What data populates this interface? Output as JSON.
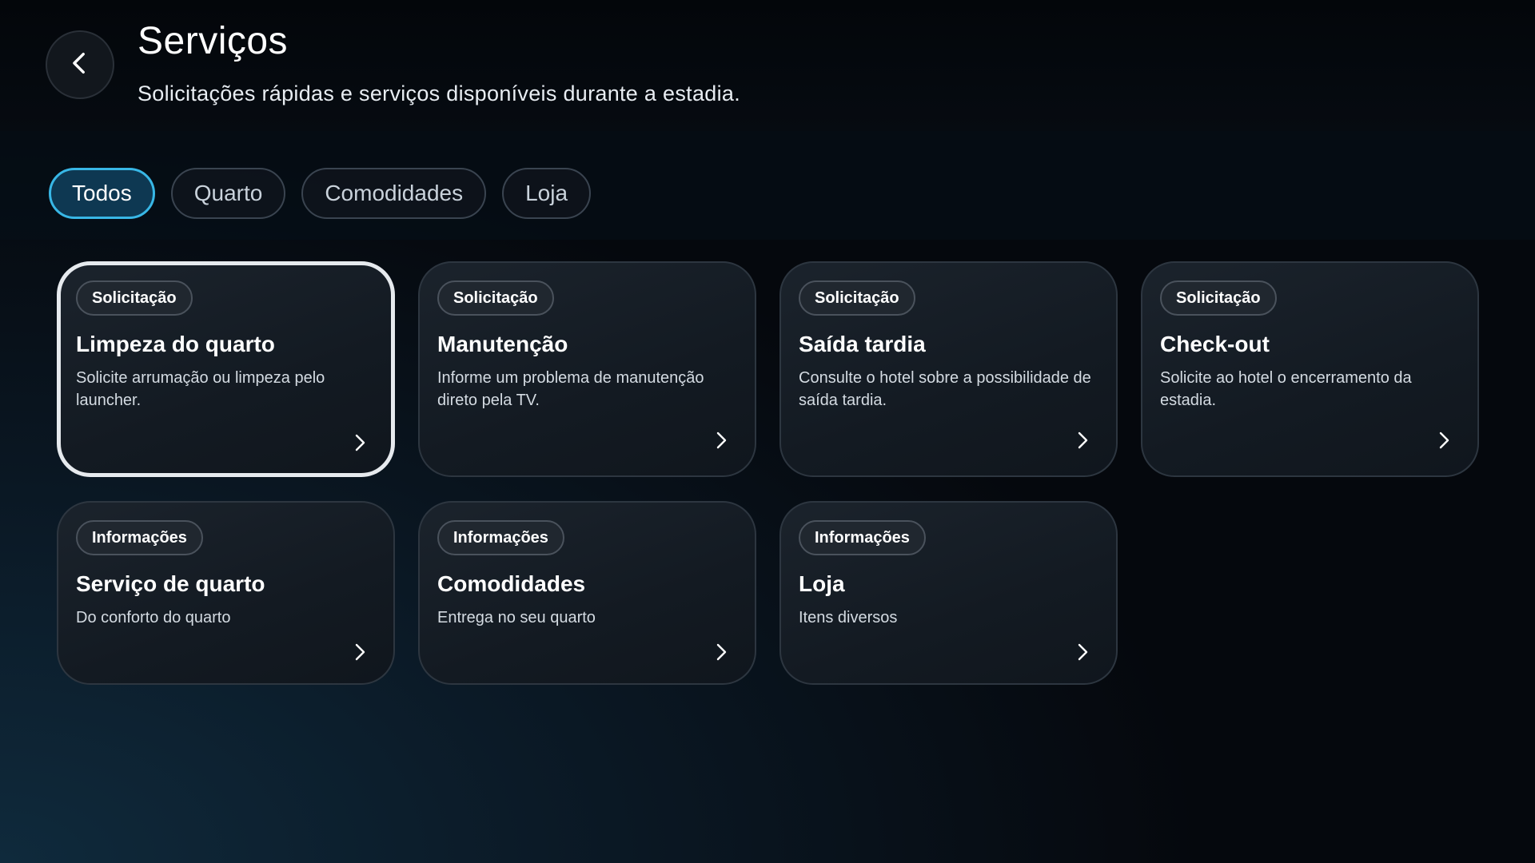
{
  "header": {
    "title": "Serviços",
    "subtitle": "Solicitações rápidas e serviços disponíveis durante a estadia.",
    "back_icon": "chevron-left-icon"
  },
  "tabs": [
    {
      "label": "Todos",
      "active": true
    },
    {
      "label": "Quarto",
      "active": false
    },
    {
      "label": "Comodidades",
      "active": false
    },
    {
      "label": "Loja",
      "active": false
    }
  ],
  "cards": [
    {
      "badge": "Solicitação",
      "title": "Limpeza do quarto",
      "description": "Solicite arrumação ou limpeza pelo launcher.",
      "focused": true,
      "icon": "chevron-right-icon"
    },
    {
      "badge": "Solicitação",
      "title": "Manutenção",
      "description": "Informe um problema de manutenção direto pela TV.",
      "focused": false,
      "icon": "chevron-right-icon"
    },
    {
      "badge": "Solicitação",
      "title": "Saída tardia",
      "description": "Consulte o hotel sobre a possibilidade de saída tardia.",
      "focused": false,
      "icon": "chevron-right-icon"
    },
    {
      "badge": "Solicitação",
      "title": "Check-out",
      "description": "Solicite ao hotel o encerramento da estadia.",
      "focused": false,
      "icon": "chevron-right-icon"
    },
    {
      "badge": "Informações",
      "title": "Serviço de quarto",
      "description": "Do conforto do quarto",
      "focused": false,
      "icon": "chevron-right-icon"
    },
    {
      "badge": "Informações",
      "title": "Comodidades",
      "description": "Entrega no seu quarto",
      "focused": false,
      "icon": "chevron-right-icon"
    },
    {
      "badge": "Informações",
      "title": "Loja",
      "description": "Itens diversos",
      "focused": false,
      "icon": "chevron-right-icon"
    }
  ],
  "colors": {
    "accent": "#38b7e6",
    "active_tab_bg": "#0e3852",
    "focus_border": "#e6eaee",
    "card_border": "#2d3640"
  }
}
